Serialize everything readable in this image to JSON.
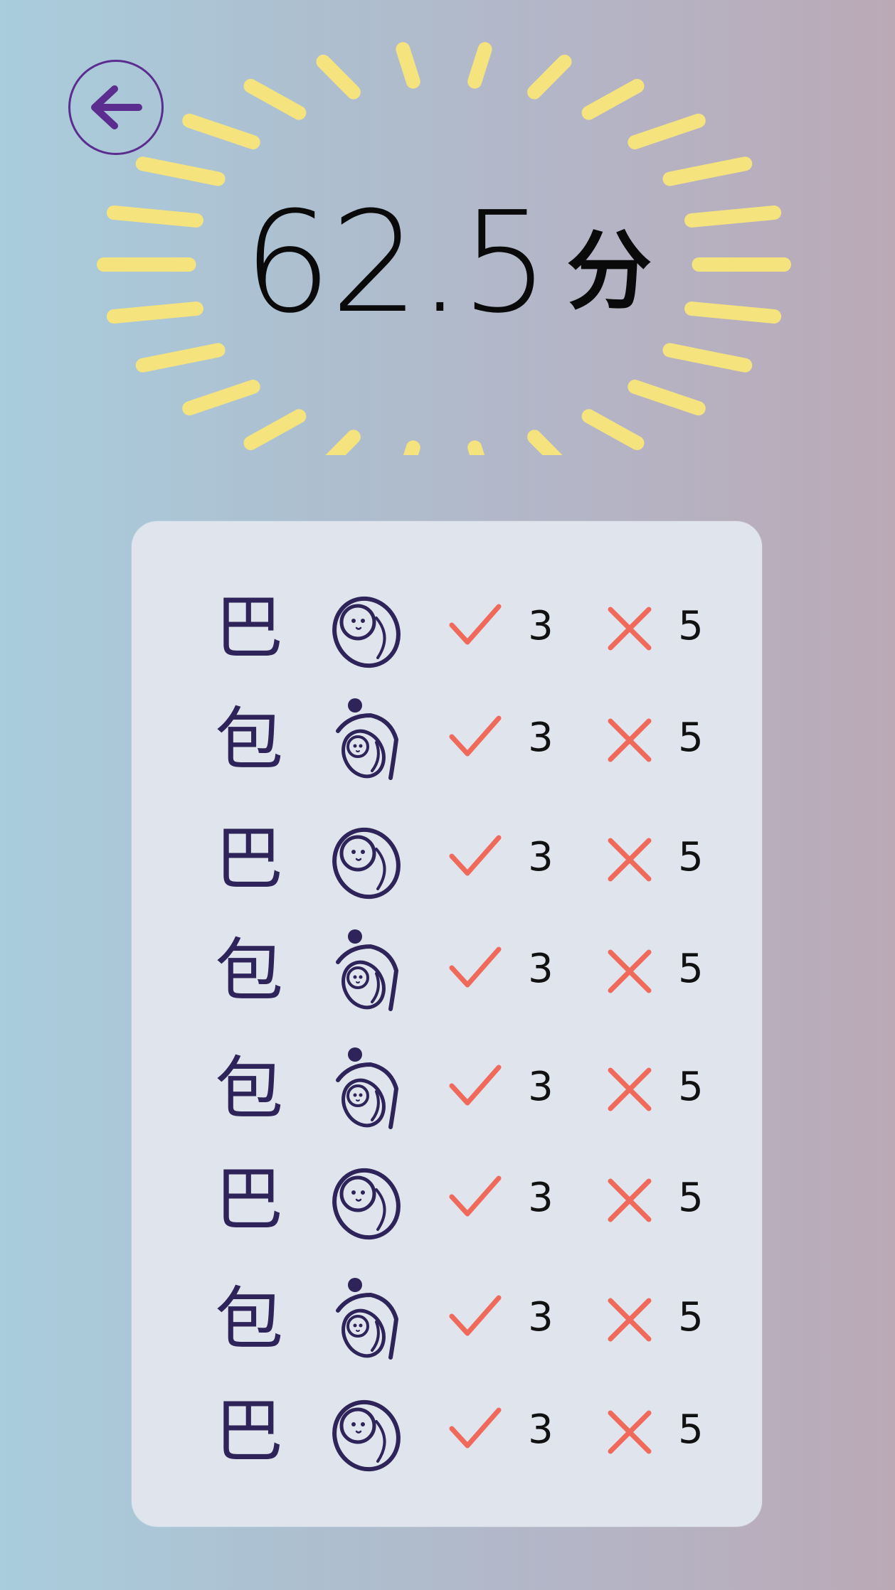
{
  "header": {
    "back_icon": "arrow-left-icon",
    "accent_color": "#5b2d8f"
  },
  "score": {
    "value": "62.5",
    "unit": "分",
    "burst_color": "#f5e37e"
  },
  "results": {
    "rows": [
      {
        "character": "巴",
        "picture": "baby-icon",
        "correct": "3",
        "wrong": "5"
      },
      {
        "character": "包",
        "picture": "person-holding-baby-icon",
        "correct": "3",
        "wrong": "5"
      },
      {
        "character": "巴",
        "picture": "baby-icon",
        "correct": "3",
        "wrong": "5"
      },
      {
        "character": "包",
        "picture": "person-holding-baby-icon",
        "correct": "3",
        "wrong": "5"
      },
      {
        "character": "包",
        "picture": "person-holding-baby-icon",
        "correct": "3",
        "wrong": "5"
      },
      {
        "character": "巴",
        "picture": "baby-icon",
        "correct": "3",
        "wrong": "5"
      },
      {
        "character": "包",
        "picture": "person-holding-baby-icon",
        "correct": "3",
        "wrong": "5"
      },
      {
        "character": "巴",
        "picture": "baby-icon",
        "correct": "3",
        "wrong": "5"
      }
    ],
    "check_icon": "check-icon",
    "cross_icon": "cross-icon",
    "mark_color": "#f06a5c",
    "icon_color": "#2e2459"
  }
}
